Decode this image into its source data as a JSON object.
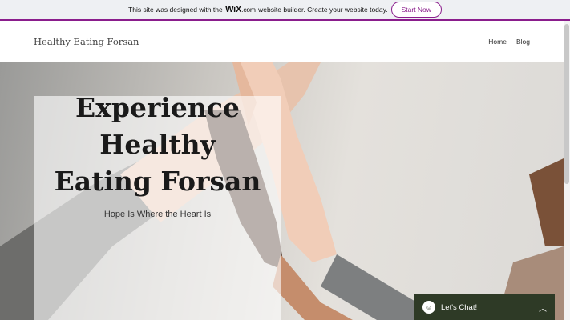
{
  "banner": {
    "prefix": "This site was designed with the",
    "logo": "WiX",
    "logo_suffix": ".com",
    "suffix": "website builder. Create your website today.",
    "cta": "Start Now",
    "accent": "#8a1d8c"
  },
  "header": {
    "site_title": "Healthy Eating Forsan",
    "nav": [
      "Home",
      "Blog"
    ]
  },
  "hero": {
    "headline_lines": [
      "Experience",
      "Healthy",
      "Eating Forsan"
    ],
    "tagline": "Hope Is Where the Heart Is"
  },
  "chat": {
    "label": "Let's Chat!",
    "icon": "chat-avatar-icon",
    "toggle_icon": "chevron-up-icon",
    "color": "#2e3a26"
  }
}
